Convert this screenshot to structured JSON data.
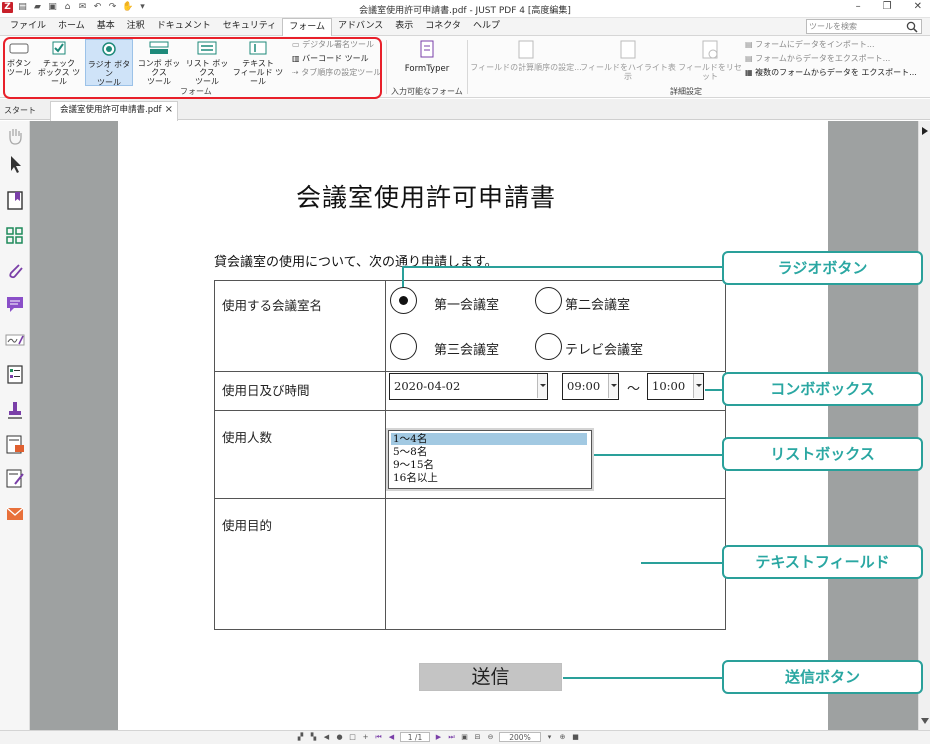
{
  "window": {
    "title": "会議室使用許可申請書.pdf - JUST PDF 4 [高度編集]"
  },
  "menu": {
    "items": [
      "ファイル",
      "ホーム",
      "基本",
      "注釈",
      "ドキュメント",
      "セキュリティ",
      "フォーム",
      "アドバンス",
      "表示",
      "コネクタ",
      "ヘルプ"
    ],
    "active": "フォーム"
  },
  "search": {
    "placeholder": "ツールを検索"
  },
  "ribbon": {
    "tools": [
      {
        "line1": "ボタン",
        "line2": "ツール"
      },
      {
        "line1": "チェック",
        "line2": "ボックス ツール"
      },
      {
        "line1": "ラジオ ボタン",
        "line2": "ツール"
      },
      {
        "line1": "コンボ ボックス",
        "line2": "ツール"
      },
      {
        "line1": "リスト ボックス",
        "line2": "ツール"
      },
      {
        "line1": "テキスト",
        "line2": "フィールド ツール"
      }
    ],
    "small_tools": [
      "デジタル署名ツール",
      "バーコード ツール",
      "タブ順序の設定ツール"
    ],
    "group_form": "フォーム",
    "formtyper": "FormTyper",
    "group_input": "入力可能なフォーム",
    "detail_tools": [
      "フィールドの計算順序の設定...",
      "フィールドをハイライト表示",
      "フィールドをリセット"
    ],
    "data_tools": [
      "フォームにデータをインポート...",
      "フォームからデータをエクスポート...",
      "複数のフォームからデータを エクスポート..."
    ],
    "group_detail": "詳細設定"
  },
  "tabs": {
    "start": "スタート",
    "doc": "会議室使用許可申請書.pdf",
    "close": "×"
  },
  "document": {
    "title": "会議室使用許可申請書",
    "intro": "貸会議室の使用について、次の通り申請します。",
    "row1_label": "使用する会議室名",
    "rooms": [
      "第一会議室",
      "第二会議室",
      "第三会議室",
      "テレビ会議室"
    ],
    "row2_label": "使用日及び時間",
    "date": "2020-04-02",
    "time_from": "09:00",
    "tilde": "～",
    "time_to": "10:00",
    "row3_label": "使用人数",
    "people_options": [
      "1～4名",
      "5～8名",
      "9～15名",
      "16名以上"
    ],
    "row4_label": "使用目的",
    "submit": "送信"
  },
  "callouts": {
    "radio": "ラジオボタン",
    "combo": "コンボボックス",
    "list": "リストボックス",
    "text": "テキストフィールド",
    "submit": "送信ボタン"
  },
  "statusbar": {
    "page": "1 /1",
    "zoom": "200%"
  },
  "colors": {
    "accent": "#2aa09a",
    "highlight_border": "#e8202a",
    "selected_tool": "#cfe3f8",
    "list_selected": "#a2c9e2"
  }
}
